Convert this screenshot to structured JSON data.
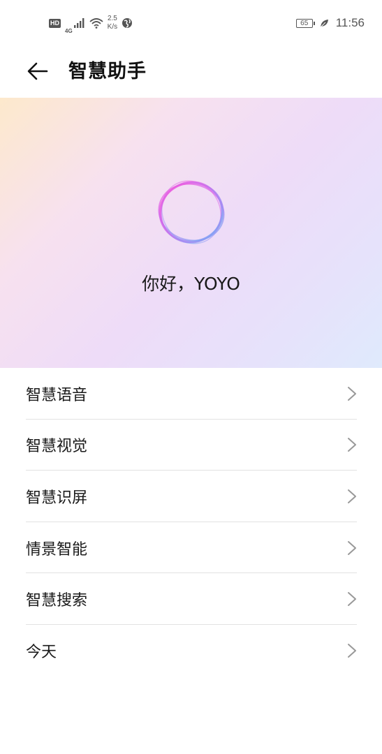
{
  "status_bar": {
    "hd": "HD",
    "network": "4G",
    "speed_value": "2.5",
    "speed_unit": "K/s",
    "battery": "65",
    "time": "11:56",
    "icons": [
      "hd-icon",
      "signal-icon",
      "wifi-icon",
      "globe-icon",
      "battery-icon",
      "leaf-icon"
    ]
  },
  "header": {
    "title": "智慧助手",
    "back_icon": "arrow-left-icon"
  },
  "hero": {
    "greeting": "你好，YOYO",
    "orb_icon": "assistant-orb-icon",
    "gradient_colors": [
      "#fde9cc",
      "#eedcf8",
      "#dfeafc"
    ]
  },
  "menu": {
    "items": [
      {
        "label": "智慧语音"
      },
      {
        "label": "智慧视觉"
      },
      {
        "label": "智慧识屏"
      },
      {
        "label": "情景智能"
      },
      {
        "label": "智慧搜索"
      },
      {
        "label": "今天"
      }
    ],
    "chevron_icon": "chevron-right-icon"
  }
}
